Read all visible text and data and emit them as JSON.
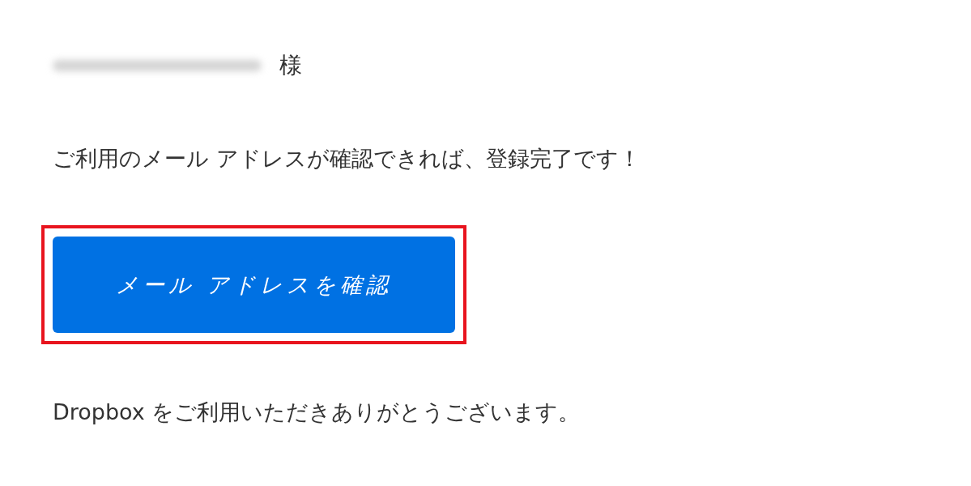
{
  "greeting": {
    "honorific": "様"
  },
  "message": "ご利用のメール アドレスが確認できれば、登録完了です！",
  "button": {
    "label": "メール アドレスを確認",
    "highlighted": true
  },
  "closing": "Dropbox をご利用いただきありがとうございます。"
}
